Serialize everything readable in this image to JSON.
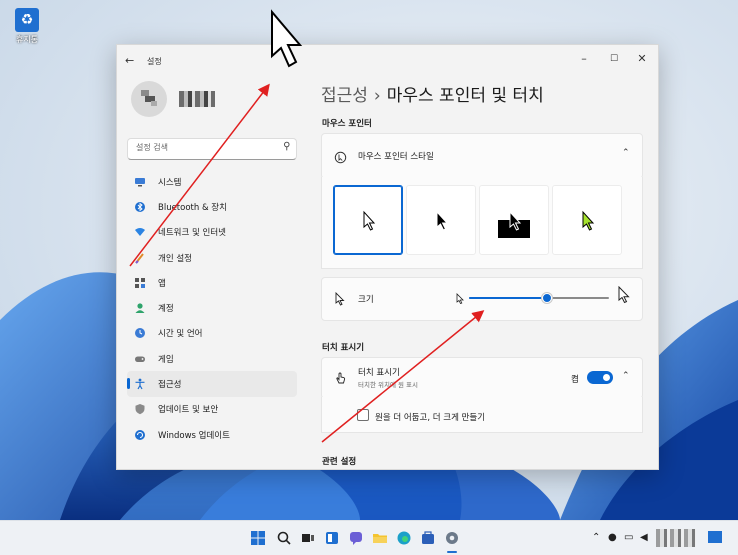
{
  "desktop": {
    "recycle_bin_label": "휴지통"
  },
  "window": {
    "app_title": "설정",
    "back_glyph": "←",
    "minimize_glyph": "–",
    "maximize_glyph": "☐",
    "close_glyph": "✕"
  },
  "sidebar": {
    "search_placeholder": "설정 검색",
    "items": [
      {
        "label": "시스템",
        "icon": "monitor-icon"
      },
      {
        "label": "Bluetooth & 장치",
        "icon": "bluetooth-icon"
      },
      {
        "label": "네트워크 및 인터넷",
        "icon": "wifi-icon"
      },
      {
        "label": "개인 설정",
        "icon": "brush-icon"
      },
      {
        "label": "앱",
        "icon": "apps-icon"
      },
      {
        "label": "계정",
        "icon": "person-icon"
      },
      {
        "label": "시간 및 언어",
        "icon": "globe-clock-icon"
      },
      {
        "label": "게임",
        "icon": "gamepad-icon"
      },
      {
        "label": "접근성",
        "icon": "accessibility-icon",
        "active": true
      },
      {
        "label": "업데이트 및 보안",
        "icon": "shield-icon"
      },
      {
        "label": "Windows 업데이트",
        "icon": "update-icon"
      }
    ]
  },
  "main": {
    "breadcrumb_parent": "접근성",
    "breadcrumb_separator": "›",
    "breadcrumb_current": "마우스 포인터 및 터치",
    "mouse_section_title": "마우스 포인터",
    "pointer_style_label": "마우스 포인터 스타일",
    "pointer_styles": [
      {
        "name": "white",
        "selected": true
      },
      {
        "name": "black",
        "selected": false
      },
      {
        "name": "inverted",
        "selected": false
      },
      {
        "name": "custom-lime",
        "selected": false
      }
    ],
    "custom_color": "#a6e22e",
    "size_label": "크기",
    "size_value": 0.56,
    "touch_section_title": "터치 표시기",
    "touch_label": "터치 표시기",
    "touch_sublabel": "터치한 위치에 원 표시",
    "touch_state": "켬",
    "touch_checkbox_label": "원을 더 어둡고, 더 크게 만들기",
    "related_section_title": "관련 설정"
  },
  "colors": {
    "accent": "#0a67d2",
    "annotation": "#e02020"
  }
}
